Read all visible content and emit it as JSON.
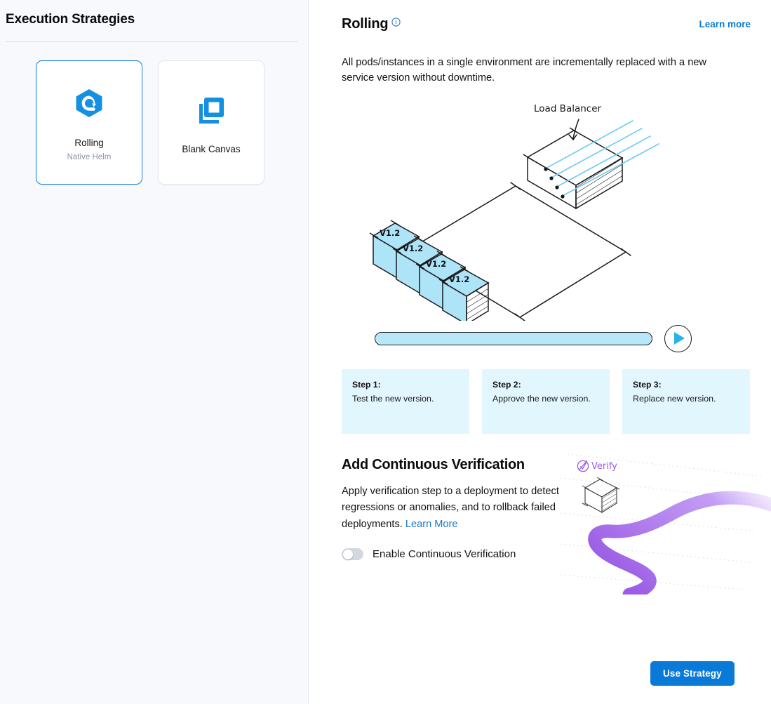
{
  "sidebar": {
    "title": "Execution Strategies",
    "cards": [
      {
        "name": "Rolling",
        "sub": "Native Helm",
        "icon": "rolling-hexagon-icon",
        "selected": true
      },
      {
        "name": "Blank Canvas",
        "sub": "",
        "icon": "blank-canvas-squares-icon",
        "selected": false
      }
    ]
  },
  "main": {
    "title": "Rolling",
    "info_icon": "info-circle-icon",
    "learn_more": "Learn more",
    "description": "All pods/instances in a single environment are incrementally replaced with a new service version without downtime.",
    "illustration": {
      "load_balancer_label": "Load Balancer",
      "pod_labels": [
        "V1.2",
        "V1.2",
        "V1.2",
        "V1.2"
      ]
    },
    "player": {
      "progress_percent": 100,
      "play_icon": "play-triangle-icon"
    },
    "steps": [
      {
        "label": "Step 1:",
        "text": "Test the new version."
      },
      {
        "label": "Step 2:",
        "text": "Approve the new version."
      },
      {
        "label": "Step 3:",
        "text": "Replace new version."
      }
    ],
    "continuous_verification": {
      "title": "Add Continuous Verification",
      "description": "Apply verification step to a deployment to detect regressions or anomalies, and to rollback failed deployments. ",
      "learn_more": "Learn More",
      "toggle_label": "Enable Continuous Verification",
      "toggle_on": false,
      "art_label": "Verify"
    },
    "use_strategy_label": "Use Strategy"
  },
  "colors": {
    "accent_blue": "#0a7ad8",
    "selected_border": "#1b7fd0",
    "step_card_bg": "#e2f6fd",
    "sidebar_bg": "#f7f9fd",
    "progress_fill": "#b8e7f8",
    "purple": "#a063e8",
    "pod_fill": "#aee4f7"
  }
}
